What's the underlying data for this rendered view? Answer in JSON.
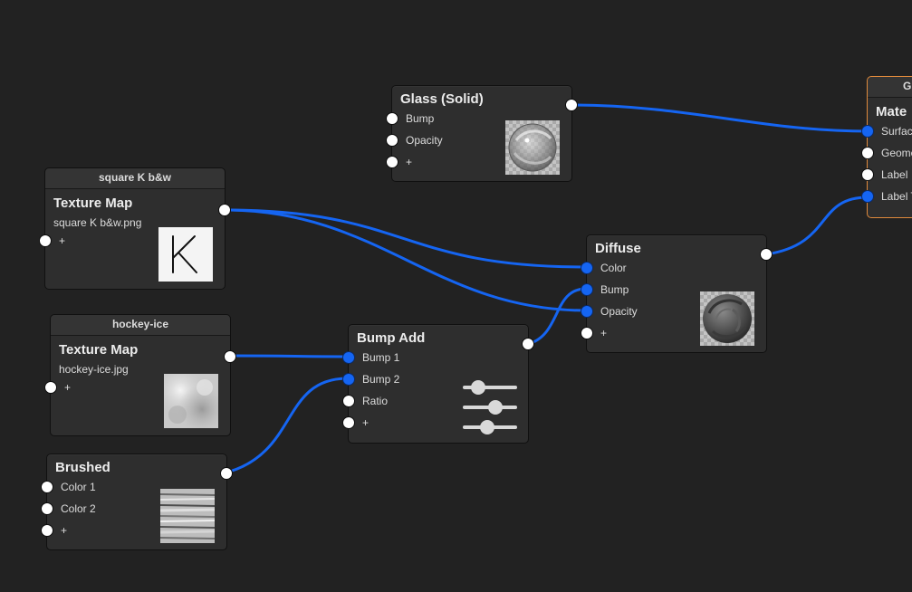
{
  "nodes": {
    "glass": {
      "title": "Glass (Solid)",
      "inputs": [
        "Bump",
        "Opacity",
        "+"
      ]
    },
    "square_k": {
      "header": "square K b&w",
      "title": "Texture Map",
      "file": "square K b&w.png",
      "inputs": [
        "+"
      ],
      "thumb_letter": "k"
    },
    "hockey": {
      "header": "hockey-ice",
      "title": "Texture Map",
      "file": "hockey-ice.jpg",
      "inputs": [
        "+"
      ]
    },
    "brushed": {
      "title": "Brushed",
      "inputs": [
        "Color 1",
        "Color 2",
        "+"
      ]
    },
    "bump_add": {
      "title": "Bump Add",
      "inputs": [
        "Bump 1",
        "Bump 2",
        "Ratio",
        "+"
      ],
      "sliders": [
        0.2,
        0.63,
        0.43
      ]
    },
    "diffuse": {
      "title": "Diffuse",
      "inputs": [
        "Color",
        "Bump",
        "Opacity",
        "+"
      ]
    },
    "material": {
      "header": "G",
      "title": "Mate",
      "inputs": [
        "Surfac",
        "Geome",
        "Label",
        "Label T"
      ]
    }
  },
  "colors": {
    "background": "#222222",
    "wire": "#1565f2",
    "connected_port": "#1565f2",
    "free_port": "#ffffff",
    "selection_outline": "#e08a3c"
  }
}
